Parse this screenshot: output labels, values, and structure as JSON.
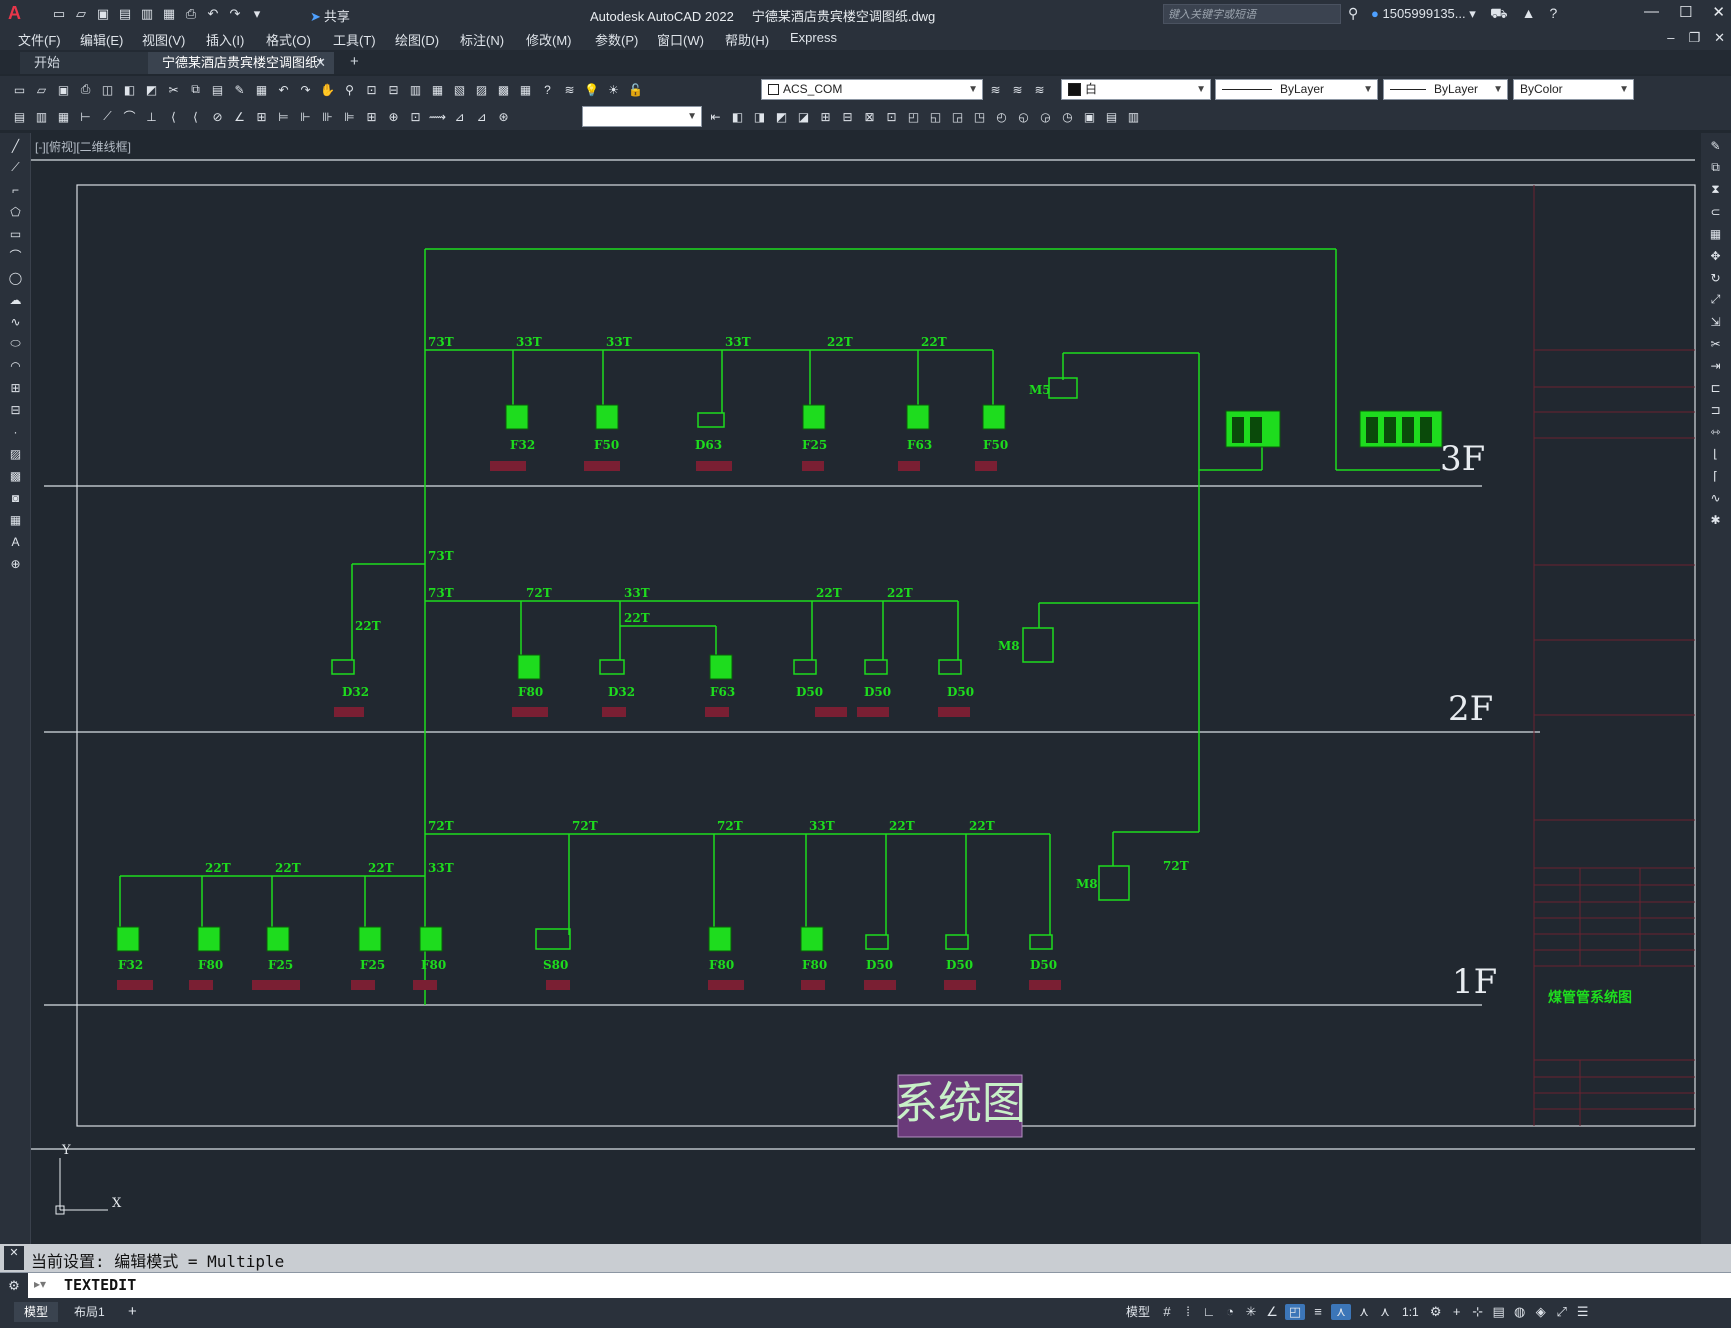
{
  "app": {
    "logo": "A",
    "title": "Autodesk AutoCAD 2022",
    "filename": "宁德某酒店贵宾楼空调图纸.dwg",
    "share_label": "共享",
    "search_placeholder": "键入关键字或短语",
    "user": "1505999135..."
  },
  "menu": [
    "文件(F)",
    "编辑(E)",
    "视图(V)",
    "插入(I)",
    "格式(O)",
    "工具(T)",
    "绘图(D)",
    "标注(N)",
    "修改(M)",
    "参数(P)",
    "窗口(W)",
    "帮助(H)",
    "Express"
  ],
  "tabs": {
    "start": "开始",
    "active": "宁德某酒店贵宾楼空调图纸*"
  },
  "toolbar": {
    "layer": "ACS_COM",
    "color": "白",
    "linetype": "ByLayer",
    "lineweight": "ByLayer",
    "plotstyle": "ByColor"
  },
  "viewport_label": "[-][俯视][二维线框]",
  "drawing": {
    "floors": [
      "3F",
      "2F",
      "1F"
    ],
    "title_block_name": "煤管管系统图",
    "banner": "系统图",
    "pipe_labels": {
      "f3": [
        "73T",
        "33T",
        "33T",
        "33T",
        "22T",
        "22T"
      ],
      "f2_riser": "73T",
      "f2_side": "22T",
      "f2": [
        "73T",
        "72T",
        "33T",
        "22T",
        "22T",
        "22T"
      ],
      "f1": [
        "72T",
        "72T",
        "72T",
        "33T",
        "22T",
        "22T"
      ],
      "f1_left": [
        "22T",
        "22T",
        "22T",
        "33T"
      ],
      "f1_m": "72T"
    },
    "units_f3": [
      "F32",
      "F50",
      "D63",
      "F25",
      "F63",
      "F50"
    ],
    "units_f2": [
      "D32",
      "F80",
      "D32",
      "F63",
      "D50",
      "D50",
      "D50"
    ],
    "units_f1": [
      "F32",
      "F80",
      "F25",
      "F25",
      "F80",
      "S80",
      "F80",
      "F80",
      "D50",
      "D50",
      "D50"
    ],
    "m_labels": [
      "M5",
      "M8",
      "M8"
    ],
    "ucs_y": "Y",
    "ucs_x": "X"
  },
  "command": {
    "history": "当前设置: 编辑模式 = Multiple",
    "current": "TEXTEDIT"
  },
  "status": {
    "model_tab": "模型",
    "layout_tab": "布局1",
    "space": "模型",
    "scale": "1:1"
  },
  "colors": {
    "pipe": "#1edc1e",
    "room_label": "#7a1f33",
    "frame_red": "#6b2230",
    "banner_bg": "#6a3a7a"
  }
}
